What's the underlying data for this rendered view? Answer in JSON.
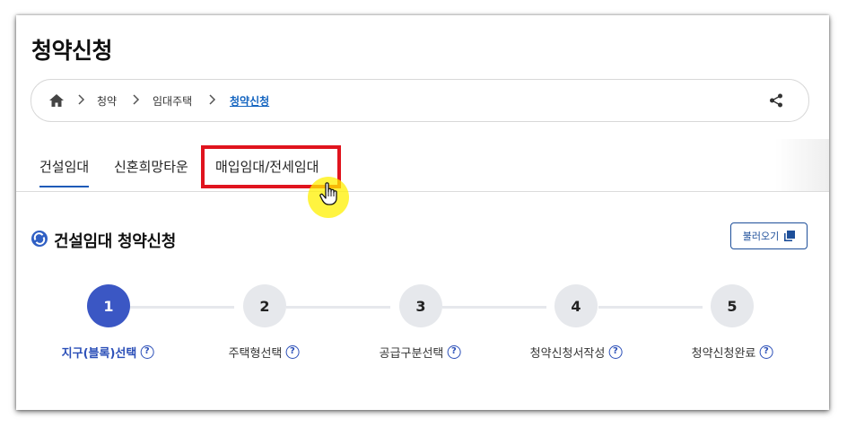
{
  "page": {
    "title": "청약신청"
  },
  "breadcrumb": {
    "items": [
      "청약",
      "임대주택",
      "청약신청"
    ],
    "home_icon": "home-icon",
    "share_icon": "share-icon"
  },
  "tabs": [
    {
      "label": "건설임대",
      "active": true
    },
    {
      "label": "신혼희망타운",
      "active": false
    },
    {
      "label": "매입임대/전세임대",
      "active": false
    }
  ],
  "section": {
    "title": "건설임대 청약신청",
    "icon": "refresh-circle-icon",
    "load_button": "불러오기",
    "load_icon": "copy-icon"
  },
  "steps": [
    {
      "number": "1",
      "label": "지구(블록)선택",
      "active": true
    },
    {
      "number": "2",
      "label": "주택형선택",
      "active": false
    },
    {
      "number": "3",
      "label": "공급구분선택",
      "active": false
    },
    {
      "number": "4",
      "label": "청약신청서작성",
      "active": false
    },
    {
      "number": "5",
      "label": "청약신청완료",
      "active": false
    }
  ],
  "help_glyph": "?",
  "colors": {
    "accent": "#3b57c4",
    "highlight": "#e0141e",
    "link": "#1565c0"
  }
}
